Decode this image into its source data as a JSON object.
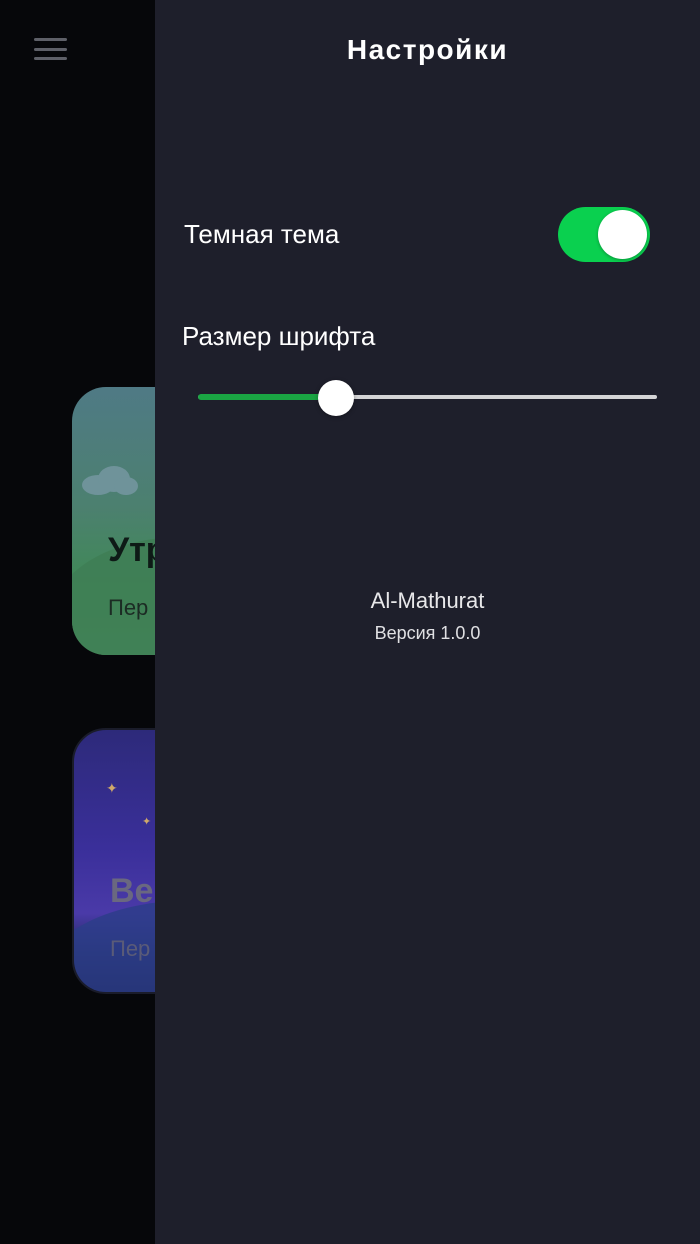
{
  "background": {
    "morning_card": {
      "title": "Утр",
      "subtitle": "Пер"
    },
    "evening_card": {
      "title": "Ве",
      "subtitle": "Пер"
    }
  },
  "settings": {
    "title": "Настройки",
    "dark_theme": {
      "label": "Темная тема",
      "enabled": true
    },
    "font_size": {
      "label": "Размер шрифта",
      "value_fraction": 0.3
    },
    "app_name": "Al-Mathurat",
    "version": "Версия 1.0.0"
  },
  "colors": {
    "accent": "#0ad04f",
    "drawer_bg": "#1e1f2b",
    "slider_fill": "#1aa543"
  },
  "icons": [
    "menu-icon"
  ]
}
